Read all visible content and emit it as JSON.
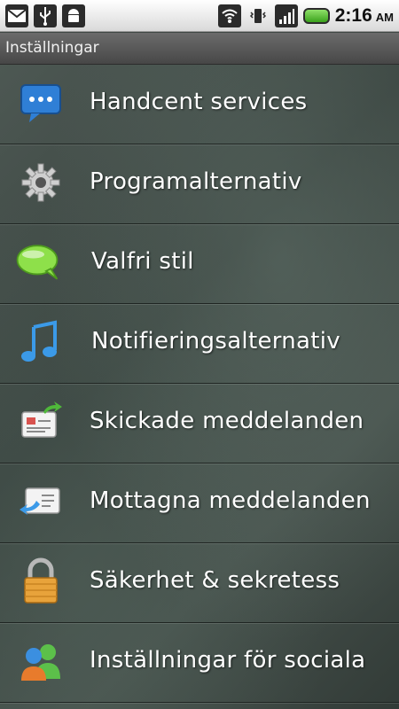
{
  "status_bar": {
    "left_icons": [
      "gmail-icon",
      "usb-icon",
      "android-debug-icon"
    ],
    "right_icons": [
      "wifi-icon",
      "vibrate-icon",
      "signal-icon",
      "battery-icon"
    ],
    "time": "2:16",
    "ampm": "AM"
  },
  "title_bar": {
    "title": "Inställningar"
  },
  "menu": {
    "items": [
      {
        "label": "Handcent services",
        "icon": "chat-bubble-icon"
      },
      {
        "label": "Programalternativ",
        "icon": "gear-icon"
      },
      {
        "label": "Valfri stil",
        "icon": "green-bubble-icon"
      },
      {
        "label": "Notifieringsalternativ",
        "icon": "music-note-icon"
      },
      {
        "label": "Skickade meddelanden",
        "icon": "sent-message-icon"
      },
      {
        "label": "Mottagna meddelanden",
        "icon": "received-message-icon"
      },
      {
        "label": "Säkerhet & sekretess",
        "icon": "padlock-icon"
      },
      {
        "label": "Inställningar för sociala",
        "icon": "people-icon"
      }
    ]
  }
}
